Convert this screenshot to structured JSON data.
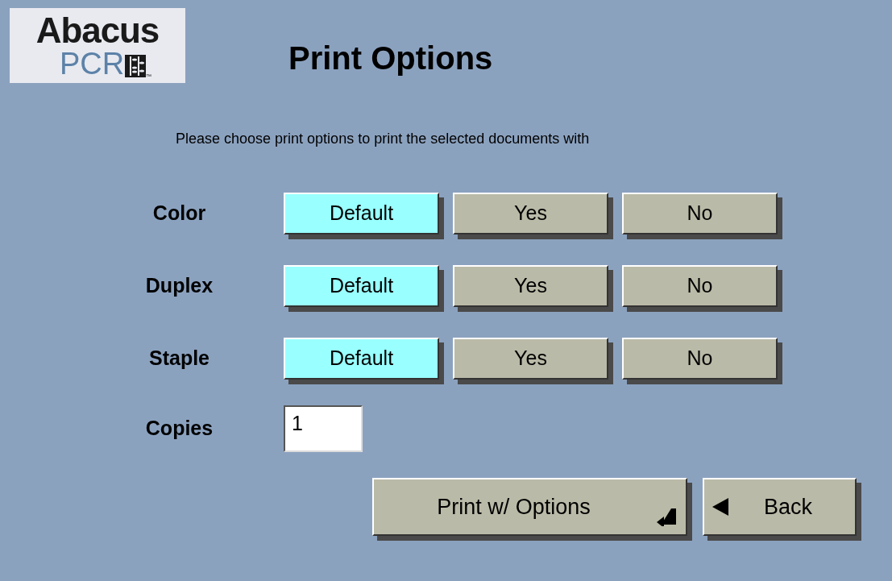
{
  "logo": {
    "line_1": "Abacus",
    "line_2": "PCR",
    "mark": "™"
  },
  "title": "Print Options",
  "instructions": "Please choose print options to print the selected documents with",
  "options": [
    {
      "label": "Color",
      "choices": [
        {
          "label": "Default",
          "selected": true
        },
        {
          "label": "Yes",
          "selected": false
        },
        {
          "label": "No",
          "selected": false
        }
      ]
    },
    {
      "label": "Duplex",
      "choices": [
        {
          "label": "Default",
          "selected": true
        },
        {
          "label": "Yes",
          "selected": false
        },
        {
          "label": "No",
          "selected": false
        }
      ]
    },
    {
      "label": "Staple",
      "choices": [
        {
          "label": "Default",
          "selected": true
        },
        {
          "label": "Yes",
          "selected": false
        },
        {
          "label": "No",
          "selected": false
        }
      ]
    }
  ],
  "copies": {
    "label": "Copies",
    "value": "1"
  },
  "buttons": [
    {
      "label": "Print w/ Options",
      "kind": "enter"
    },
    {
      "label": "Back",
      "kind": "back"
    }
  ]
}
